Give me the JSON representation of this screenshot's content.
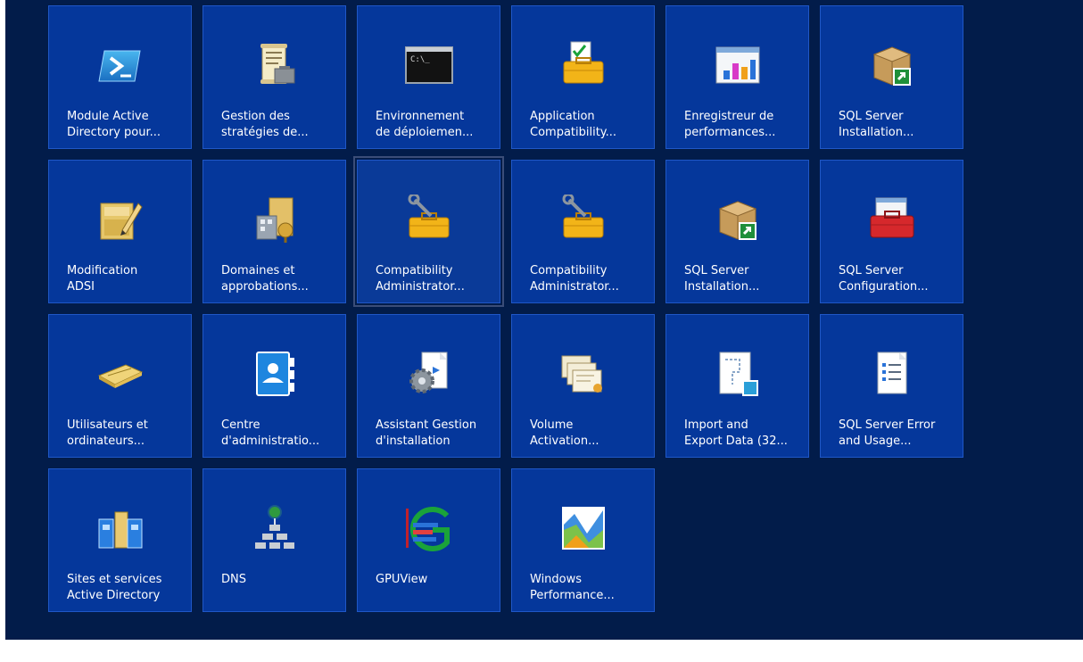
{
  "tiles": [
    {
      "id": "module-active-directory",
      "line1": "Module Active",
      "line2": "Directory pour...",
      "icon": "powershell-icon"
    },
    {
      "id": "gestion-strategies",
      "line1": "Gestion des",
      "line2": "stratégies de...",
      "icon": "policy-scroll-icon"
    },
    {
      "id": "environnement-deploiement",
      "line1": "Environnement",
      "line2": "de déploiemen...",
      "icon": "command-prompt-icon"
    },
    {
      "id": "application-compatibility",
      "line1": "Application",
      "line2": "Compatibility...",
      "icon": "checklist-toolbox-icon"
    },
    {
      "id": "enregistreur-performances",
      "line1": "Enregistreur de",
      "line2": "performances...",
      "icon": "bar-chart-window-icon"
    },
    {
      "id": "sql-server-installation-1",
      "line1": "SQL Server",
      "line2": "Installation...",
      "icon": "package-box-icon"
    },
    {
      "id": "modification-adsi",
      "line1": "Modification",
      "line2": "ADSI",
      "icon": "edit-folder-icon"
    },
    {
      "id": "domaines-approbations",
      "line1": "Domaines et",
      "line2": "approbations...",
      "icon": "domain-buildings-icon"
    },
    {
      "id": "compatibility-administrator-1",
      "line1": "Compatibility",
      "line2": "Administrator...",
      "icon": "wrench-toolbox-icon"
    },
    {
      "id": "compatibility-administrator-2",
      "line1": "Compatibility",
      "line2": "Administrator...",
      "icon": "wrench-toolbox-icon"
    },
    {
      "id": "sql-server-installation-2",
      "line1": "SQL Server",
      "line2": "Installation...",
      "icon": "package-box-icon"
    },
    {
      "id": "sql-server-configuration",
      "line1": "SQL Server",
      "line2": "Configuration...",
      "icon": "red-toolbox-icon"
    },
    {
      "id": "utilisateurs-ordinateurs",
      "line1": "Utilisateurs et",
      "line2": "ordinateurs...",
      "icon": "directory-book-icon"
    },
    {
      "id": "centre-administration",
      "line1": "Centre",
      "line2": "d'administratio...",
      "icon": "contact-card-icon"
    },
    {
      "id": "assistant-gestion-installation",
      "line1": "Assistant Gestion",
      "line2": "d'installation",
      "icon": "gear-document-icon"
    },
    {
      "id": "volume-activation",
      "line1": "Volume",
      "line2": "Activation...",
      "icon": "certificates-icon"
    },
    {
      "id": "import-export-data",
      "line1": "Import and",
      "line2": "Export Data (32...",
      "icon": "data-document-icon"
    },
    {
      "id": "sql-server-error-usage",
      "line1": "SQL Server Error",
      "line2": "and Usage...",
      "icon": "report-document-icon"
    },
    {
      "id": "sites-services-ad",
      "line1": "Sites et services",
      "line2": "Active Directory",
      "icon": "sites-buildings-icon"
    },
    {
      "id": "dns",
      "line1": "DNS",
      "line2": "",
      "icon": "dns-network-icon"
    },
    {
      "id": "gpuview",
      "line1": "GPUView",
      "line2": "",
      "icon": "gpuview-icon"
    },
    {
      "id": "windows-performance",
      "line1": "Windows",
      "line2": "Performance...",
      "icon": "performance-graph-icon"
    }
  ],
  "selected_tile": "compatibility-administrator-1"
}
